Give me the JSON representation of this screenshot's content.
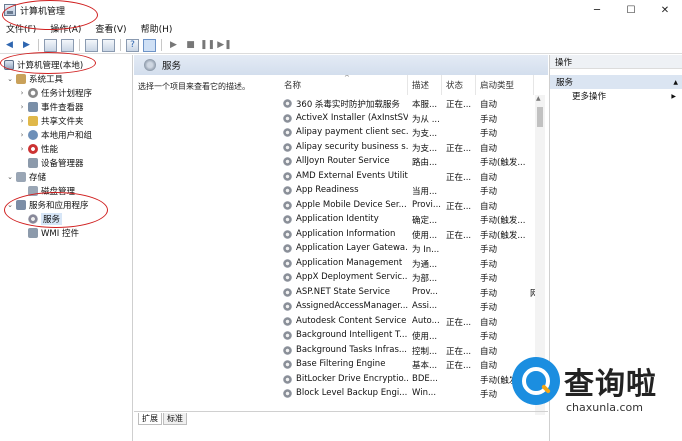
{
  "window": {
    "title": "计算机管理",
    "min": "─",
    "max": "☐",
    "close": "✕"
  },
  "menu": [
    "文件(F)",
    "操作(A)",
    "查看(V)",
    "帮助(H)"
  ],
  "tree": {
    "root": "计算机管理(本地)",
    "system_tools": "系统工具",
    "task_scheduler": "任务计划程序",
    "event_viewer": "事件查看器",
    "shared_folders": "共享文件夹",
    "local_users": "本地用户和组",
    "performance": "性能",
    "device_manager": "设备管理器",
    "storage": "存储",
    "disk_management": "磁盘管理",
    "services_apps": "服务和应用程序",
    "services": "服务",
    "wmi": "WMI 控件"
  },
  "center": {
    "header": "服务",
    "description": "选择一个项目来查看它的描述。",
    "columns": [
      "名称",
      "描述",
      "状态",
      "启动类型"
    ],
    "tabs": [
      "扩展",
      "标准"
    ],
    "rows": [
      {
        "name": "360 杀毒实时防护加载服务",
        "desc": "本服...",
        "status": "正在...",
        "startup": "自动",
        "logon": ""
      },
      {
        "name": "ActiveX Installer (AxInstSV)",
        "desc": "为从 ...",
        "status": "",
        "startup": "手动",
        "logon": ""
      },
      {
        "name": "Alipay payment client sec...",
        "desc": "为支...",
        "status": "",
        "startup": "手动",
        "logon": ""
      },
      {
        "name": "Alipay security business s...",
        "desc": "为支...",
        "status": "正在...",
        "startup": "自动",
        "logon": ""
      },
      {
        "name": "AllJoyn Router Service",
        "desc": "路由...",
        "status": "",
        "startup": "手动(触发...",
        "logon": ""
      },
      {
        "name": "AMD External Events Utility",
        "desc": "",
        "status": "正在...",
        "startup": "自动",
        "logon": ""
      },
      {
        "name": "App Readiness",
        "desc": "当用...",
        "status": "",
        "startup": "手动",
        "logon": ""
      },
      {
        "name": "Apple Mobile Device Ser...",
        "desc": "Provi...",
        "status": "正在...",
        "startup": "自动",
        "logon": ""
      },
      {
        "name": "Application Identity",
        "desc": "确定...",
        "status": "",
        "startup": "手动(触发...",
        "logon": ""
      },
      {
        "name": "Application Information",
        "desc": "使用...",
        "status": "正在...",
        "startup": "手动(触发...",
        "logon": ""
      },
      {
        "name": "Application Layer Gatewa...",
        "desc": "为 In...",
        "status": "",
        "startup": "手动",
        "logon": ""
      },
      {
        "name": "Application Management",
        "desc": "为通...",
        "status": "",
        "startup": "手动",
        "logon": ""
      },
      {
        "name": "AppX Deployment Servic...",
        "desc": "为部...",
        "status": "",
        "startup": "手动",
        "logon": ""
      },
      {
        "name": "ASP.NET State Service",
        "desc": "Prov...",
        "status": "",
        "startup": "手动",
        "logon": "网"
      },
      {
        "name": "AssignedAccessManager...",
        "desc": "Assi...",
        "status": "",
        "startup": "手动",
        "logon": ""
      },
      {
        "name": "Autodesk Content Service",
        "desc": "Auto...",
        "status": "正在...",
        "startup": "自动",
        "logon": ""
      },
      {
        "name": "Background Intelligent T...",
        "desc": "使用...",
        "status": "",
        "startup": "手动",
        "logon": ""
      },
      {
        "name": "Background Tasks Infras...",
        "desc": "控制...",
        "status": "正在...",
        "startup": "自动",
        "logon": ""
      },
      {
        "name": "Base Filtering Engine",
        "desc": "基本...",
        "status": "正在...",
        "startup": "自动",
        "logon": ""
      },
      {
        "name": "BitLocker Drive Encryptio...",
        "desc": "BDE...",
        "status": "",
        "startup": "手动(触发...",
        "logon": ""
      },
      {
        "name": "Block Level Backup Engi...",
        "desc": "Win...",
        "status": "",
        "startup": "手动",
        "logon": ""
      }
    ]
  },
  "actions": {
    "header": "操作",
    "section": "服务",
    "section_arrow": "▲",
    "more": "更多操作",
    "more_arrow": "▶"
  },
  "watermark": {
    "cn": "查询啦",
    "en": "chaxunla.com"
  },
  "colors": {
    "annotation": "#d02020",
    "selection": "#d7e6f7",
    "header_blue": "#dbe5f2",
    "watermark_blue": "#1b8ee0"
  }
}
